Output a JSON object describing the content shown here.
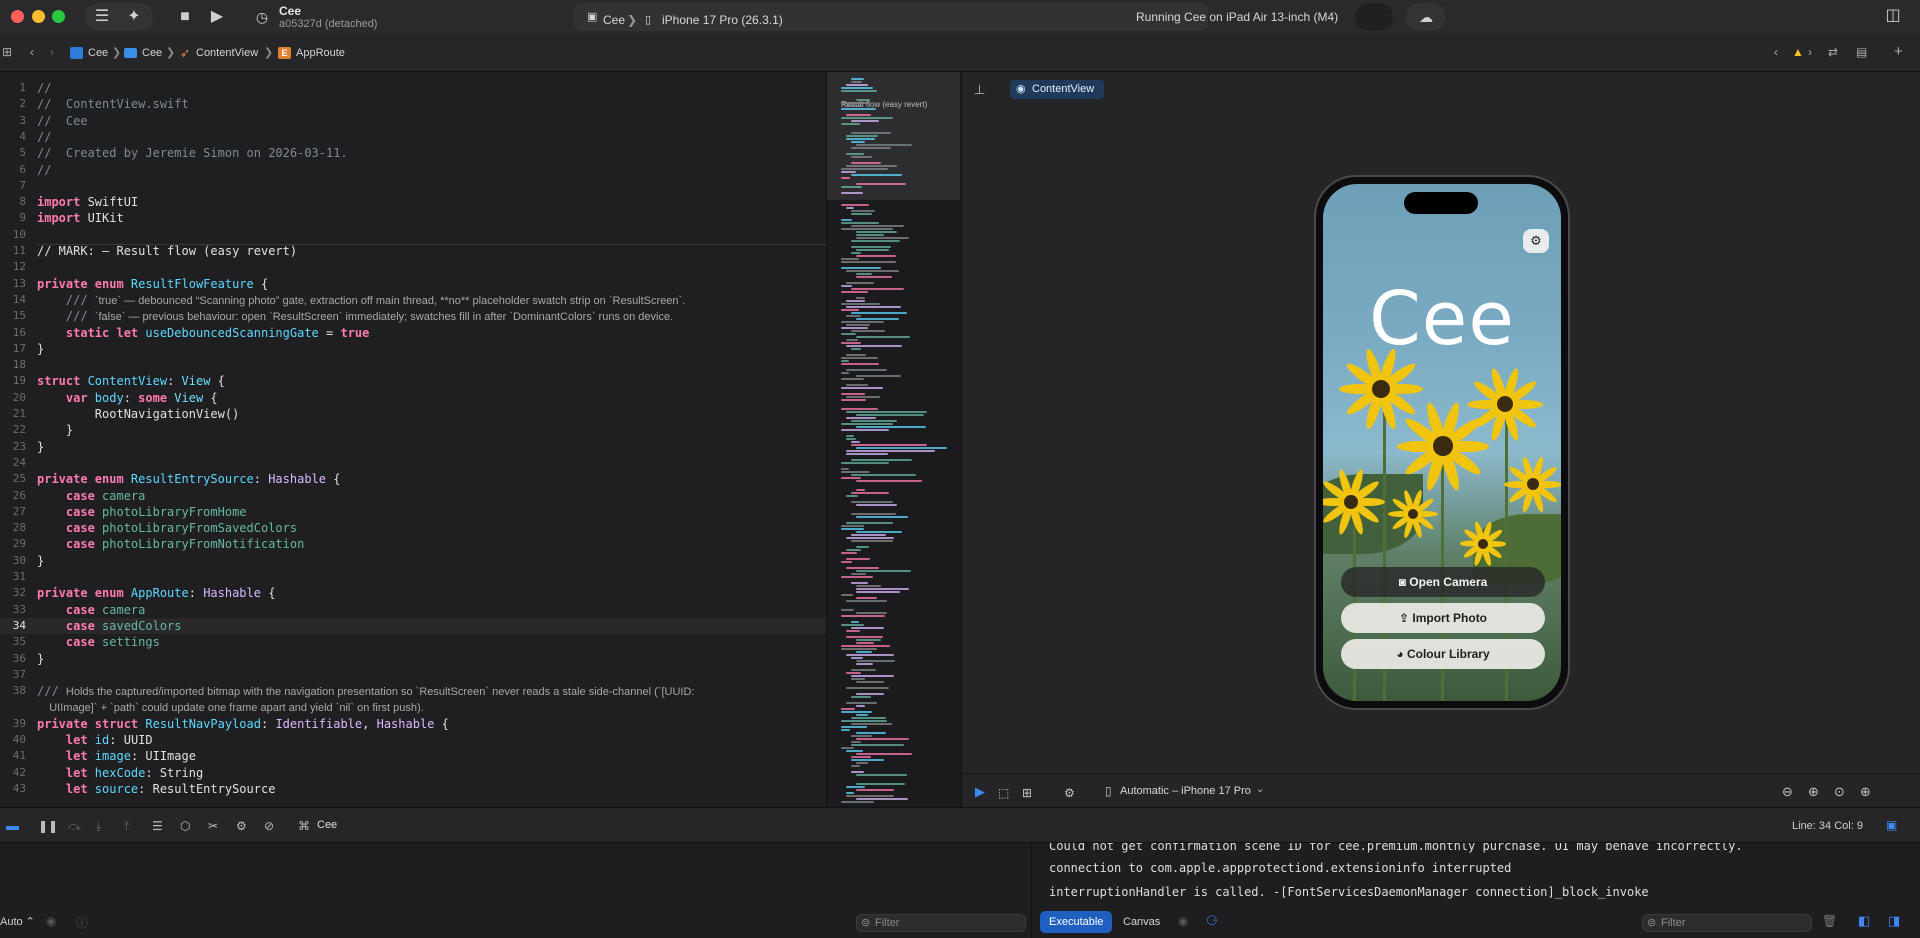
{
  "titlebar": {
    "scheme_name": "Cee",
    "scheme_commit": "a05327d (detached)",
    "destination_scheme": "Cee",
    "destination_device": "iPhone 17 Pro (26.3.1)",
    "status": "Running Cee on iPad Air 13-inch (M4)"
  },
  "jumpbar": {
    "crumbs": [
      "Cee",
      "Cee",
      "ContentView",
      "AppRoute"
    ]
  },
  "editor": {
    "current_line": 34,
    "lines": [
      {
        "n": "1",
        "parts": [
          {
            "t": "//",
            "c": "c-cmt"
          }
        ]
      },
      {
        "n": "2",
        "parts": [
          {
            "t": "//  ContentView.swift",
            "c": "c-cmt"
          }
        ]
      },
      {
        "n": "3",
        "parts": [
          {
            "t": "//  Cee",
            "c": "c-cmt"
          }
        ]
      },
      {
        "n": "4",
        "parts": [
          {
            "t": "//",
            "c": "c-cmt"
          }
        ]
      },
      {
        "n": "5",
        "parts": [
          {
            "t": "//  Created by Jeremie Simon on 2026-03-11.",
            "c": "c-cmt"
          }
        ]
      },
      {
        "n": "6",
        "parts": [
          {
            "t": "//",
            "c": "c-cmt"
          }
        ]
      },
      {
        "n": "7",
        "parts": []
      },
      {
        "n": "8",
        "parts": [
          {
            "t": "import",
            "c": "c-kw"
          },
          {
            "t": " SwiftUI",
            "c": "c-plain"
          }
        ]
      },
      {
        "n": "9",
        "parts": [
          {
            "t": "import",
            "c": "c-kw"
          },
          {
            "t": " UIKit",
            "c": "c-plain"
          }
        ]
      },
      {
        "n": "10",
        "parts": []
      },
      {
        "n": "11",
        "parts": [
          {
            "t": "// MARK: — Result flow (easy revert)",
            "c": "c-plain"
          }
        ]
      },
      {
        "n": "12",
        "parts": []
      },
      {
        "n": "13",
        "parts": [
          {
            "t": "private enum",
            "c": "c-kw"
          },
          {
            "t": " ResultFlowFeature",
            "c": "c-decl"
          },
          {
            "t": " {",
            "c": "c-plain"
          }
        ]
      },
      {
        "n": "14",
        "parts": [
          {
            "t": "    /// ",
            "c": "c-cmt"
          },
          {
            "t": "`true` — debounced “Scanning photo” gate, extraction off main thread, **no** placeholder swatch strip on `ResultScreen`.",
            "c": "doc"
          }
        ]
      },
      {
        "n": "15",
        "parts": [
          {
            "t": "    /// ",
            "c": "c-cmt"
          },
          {
            "t": "`false` — previous behaviour: open `ResultScreen` immediately; swatches fill in after `DominantColors` runs on device.",
            "c": "doc"
          }
        ]
      },
      {
        "n": "16",
        "parts": [
          {
            "t": "    static let",
            "c": "c-kw"
          },
          {
            "t": " useDebouncedScanningGate",
            "c": "c-decl"
          },
          {
            "t": " = ",
            "c": "c-plain"
          },
          {
            "t": "true",
            "c": "c-kw"
          }
        ]
      },
      {
        "n": "17",
        "parts": [
          {
            "t": "}",
            "c": "c-plain"
          }
        ]
      },
      {
        "n": "18",
        "parts": []
      },
      {
        "n": "19",
        "parts": [
          {
            "t": "struct",
            "c": "c-kw"
          },
          {
            "t": " ContentView",
            "c": "c-decl"
          },
          {
            "t": ": ",
            "c": "c-plain"
          },
          {
            "t": "View",
            "c": "c-type"
          },
          {
            "t": " {",
            "c": "c-plain"
          }
        ]
      },
      {
        "n": "20",
        "parts": [
          {
            "t": "    var",
            "c": "c-kw"
          },
          {
            "t": " body",
            "c": "c-decl"
          },
          {
            "t": ": ",
            "c": "c-plain"
          },
          {
            "t": "some",
            "c": "c-kw"
          },
          {
            "t": " View",
            "c": "c-type"
          },
          {
            "t": " {",
            "c": "c-plain"
          }
        ]
      },
      {
        "n": "21",
        "parts": [
          {
            "t": "        RootNavigationView()",
            "c": "c-plain"
          }
        ]
      },
      {
        "n": "22",
        "parts": [
          {
            "t": "    }",
            "c": "c-plain"
          }
        ]
      },
      {
        "n": "23",
        "parts": [
          {
            "t": "}",
            "c": "c-plain"
          }
        ]
      },
      {
        "n": "24",
        "parts": []
      },
      {
        "n": "25",
        "parts": [
          {
            "t": "private enum",
            "c": "c-kw"
          },
          {
            "t": " ResultEntrySource",
            "c": "c-decl"
          },
          {
            "t": ": ",
            "c": "c-plain"
          },
          {
            "t": "Hashable",
            "c": "c-proj"
          },
          {
            "t": " {",
            "c": "c-plain"
          }
        ]
      },
      {
        "n": "26",
        "parts": [
          {
            "t": "    case",
            "c": "c-kw"
          },
          {
            "t": " camera",
            "c": "c-name"
          }
        ]
      },
      {
        "n": "27",
        "parts": [
          {
            "t": "    case",
            "c": "c-kw"
          },
          {
            "t": " photoLibraryFromHome",
            "c": "c-name"
          }
        ]
      },
      {
        "n": "28",
        "parts": [
          {
            "t": "    case",
            "c": "c-kw"
          },
          {
            "t": " photoLibraryFromSavedColors",
            "c": "c-name"
          }
        ]
      },
      {
        "n": "29",
        "parts": [
          {
            "t": "    case",
            "c": "c-kw"
          },
          {
            "t": " photoLibraryFromNotification",
            "c": "c-name"
          }
        ]
      },
      {
        "n": "30",
        "parts": [
          {
            "t": "}",
            "c": "c-plain"
          }
        ]
      },
      {
        "n": "31",
        "parts": []
      },
      {
        "n": "32",
        "parts": [
          {
            "t": "private enum",
            "c": "c-kw"
          },
          {
            "t": " AppRoute",
            "c": "c-decl"
          },
          {
            "t": ": ",
            "c": "c-plain"
          },
          {
            "t": "Hashable",
            "c": "c-proj"
          },
          {
            "t": " {",
            "c": "c-plain"
          }
        ]
      },
      {
        "n": "33",
        "parts": [
          {
            "t": "    case",
            "c": "c-kw"
          },
          {
            "t": " camera",
            "c": "c-name"
          }
        ]
      },
      {
        "n": "34",
        "parts": [
          {
            "t": "    case",
            "c": "c-kw"
          },
          {
            "t": " savedColors",
            "c": "c-name"
          }
        ]
      },
      {
        "n": "35",
        "parts": [
          {
            "t": "    case",
            "c": "c-kw"
          },
          {
            "t": " settings",
            "c": "c-name"
          }
        ]
      },
      {
        "n": "36",
        "parts": [
          {
            "t": "}",
            "c": "c-plain"
          }
        ]
      },
      {
        "n": "37",
        "parts": []
      },
      {
        "n": "38",
        "parts": [
          {
            "t": "/// ",
            "c": "c-cmt"
          },
          {
            "t": "Holds the captured/imported bitmap with the navigation presentation so `ResultScreen` never reads a stale side-channel (`[UUID:",
            "c": "doc"
          }
        ]
      },
      {
        "n": "",
        "parts": [
          {
            "t": "    UIImage]` + `path` could update one frame apart and yield `nil` on first push).",
            "c": "doc"
          }
        ]
      },
      {
        "n": "39",
        "parts": [
          {
            "t": "private struct",
            "c": "c-kw"
          },
          {
            "t": " ResultNavPayload",
            "c": "c-decl"
          },
          {
            "t": ": ",
            "c": "c-plain"
          },
          {
            "t": "Identifiable",
            "c": "c-proj"
          },
          {
            "t": ", ",
            "c": "c-plain"
          },
          {
            "t": "Hashable",
            "c": "c-proj"
          },
          {
            "t": " {",
            "c": "c-plain"
          }
        ]
      },
      {
        "n": "40",
        "parts": [
          {
            "t": "    let",
            "c": "c-kw"
          },
          {
            "t": " id",
            "c": "c-decl"
          },
          {
            "t": ": UUID",
            "c": "c-plain"
          }
        ]
      },
      {
        "n": "41",
        "parts": [
          {
            "t": "    let",
            "c": "c-kw"
          },
          {
            "t": " image",
            "c": "c-decl"
          },
          {
            "t": ": UIImage",
            "c": "c-plain"
          }
        ]
      },
      {
        "n": "42",
        "parts": [
          {
            "t": "    let",
            "c": "c-kw"
          },
          {
            "t": " hexCode",
            "c": "c-decl"
          },
          {
            "t": ": String",
            "c": "c-plain"
          }
        ]
      },
      {
        "n": "43",
        "parts": [
          {
            "t": "    let",
            "c": "c-kw"
          },
          {
            "t": " source",
            "c": "c-decl"
          },
          {
            "t": ": ResultEntrySource",
            "c": "c-plain"
          }
        ]
      }
    ]
  },
  "minimap": {
    "label": "Result flow (easy revert)"
  },
  "preview": {
    "tab_label": "ContentView",
    "device_menu": "Automatic – iPhone 17 Pro",
    "app": {
      "logo": "Cee",
      "buttons": [
        "Open Camera",
        "Import Photo",
        "Colour Library"
      ]
    }
  },
  "debug": {
    "target": "Cee",
    "cursor": "Line: 34  Col: 9"
  },
  "console": {
    "lines": [
      "Could not get confirmation scene ID for cee.premium.monthly purchase. UI may behave incorrectly.",
      "connection to com.apple.appprotectiond.extensioninfo interrupted",
      "interruptionHandler is called. -[FontServicesDaemonManager connection]_block_invoke"
    ]
  },
  "bottom": {
    "auto_label": "Auto ⌃",
    "filter_placeholder": "Filter",
    "console_filter_placeholder": "Filter",
    "seg_executable": "Executable",
    "seg_canvas": "Canvas"
  },
  "colors": {
    "accent": "#1f5fbf",
    "keyword": "#ff7ab2",
    "type": "#5dd8ff",
    "comment": "#7f8a93"
  }
}
